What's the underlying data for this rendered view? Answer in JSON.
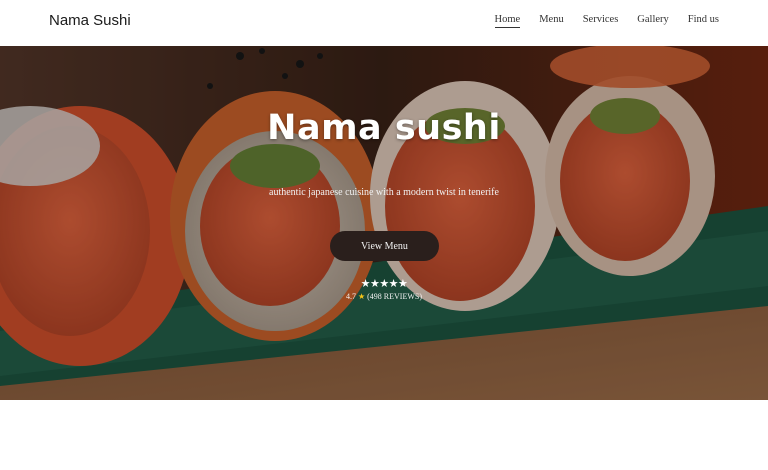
{
  "header": {
    "brand": "Nama Sushi",
    "nav": [
      {
        "label": "Home",
        "active": true
      },
      {
        "label": "Menu"
      },
      {
        "label": "Services"
      },
      {
        "label": "Gallery"
      },
      {
        "label": "Find us"
      }
    ]
  },
  "hero": {
    "title": "Nama sushi",
    "subtitle": "authentic japanese cuisine with a modern twist in tenerife",
    "cta_label": "View Menu",
    "stars": "★★★★★",
    "rating_value": "4.7",
    "reviews_text": "(498 REVIEWS)"
  },
  "colors": {
    "button_bg": "#2a1f1c",
    "star_accent": "#f5c518",
    "leaf_green": "#1f5a45"
  },
  "icons": {
    "rating_star": "star-icon"
  }
}
